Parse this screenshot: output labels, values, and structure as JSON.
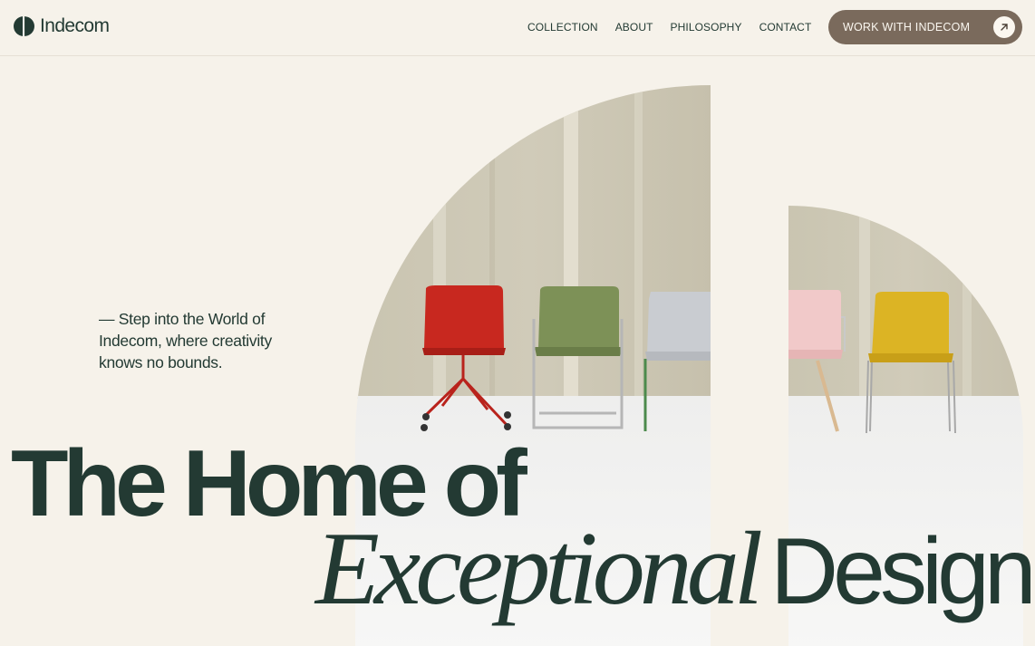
{
  "header": {
    "brand": "Indecom",
    "nav": [
      {
        "label": "COLLECTION"
      },
      {
        "label": "ABOUT"
      },
      {
        "label": "PHILOSOPHY"
      },
      {
        "label": "CONTACT"
      }
    ],
    "cta": {
      "label": "WORK WITH INDECOM",
      "icon": "arrow-up-right-icon"
    }
  },
  "hero": {
    "tagline": "— Step into the World of Indecom, where creativity knows no bounds.",
    "headline_line1": "The Home of",
    "headline_italic": "Exceptional",
    "headline_word": "Design"
  },
  "colors": {
    "background": "#f6f2ea",
    "text": "#233a33",
    "cta_background": "#7a6a5c",
    "chair_red": "#c8281f",
    "chair_green": "#7d9157",
    "chair_grey": "#c9ccd1",
    "chair_pink": "#f1c9c9",
    "chair_yellow": "#dcb424"
  }
}
